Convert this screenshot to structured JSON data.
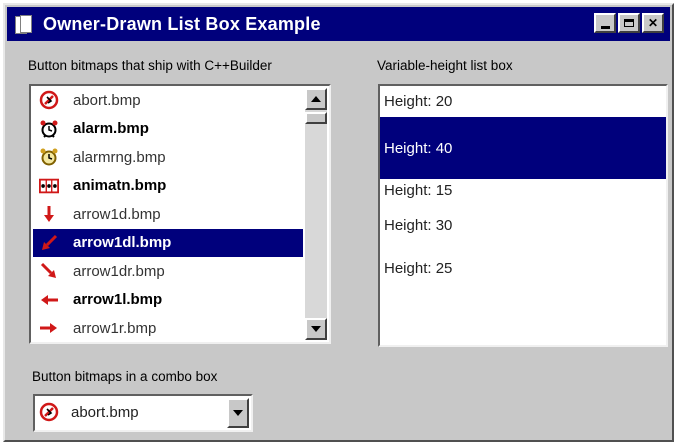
{
  "window": {
    "title": "Owner-Drawn List Box Example"
  },
  "left_list": {
    "label": "Button bitmaps that ship with C++Builder",
    "items": [
      {
        "label": "abort.bmp",
        "icon": "abort-icon",
        "bold": false,
        "selected": false
      },
      {
        "label": "alarm.bmp",
        "icon": "alarm-clock-icon",
        "bold": true,
        "selected": false
      },
      {
        "label": "alarmrng.bmp",
        "icon": "alarm-ringing-icon",
        "bold": false,
        "selected": false
      },
      {
        "label": "animatn.bmp",
        "icon": "animation-icon",
        "bold": true,
        "selected": false
      },
      {
        "label": "arrow1d.bmp",
        "icon": "arrow-down-icon",
        "bold": false,
        "selected": false
      },
      {
        "label": "arrow1dl.bmp",
        "icon": "arrow-down-left-icon",
        "bold": true,
        "selected": true
      },
      {
        "label": "arrow1dr.bmp",
        "icon": "arrow-down-right-icon",
        "bold": false,
        "selected": false
      },
      {
        "label": "arrow1l.bmp",
        "icon": "arrow-left-icon",
        "bold": true,
        "selected": false
      },
      {
        "label": "arrow1r.bmp",
        "icon": "arrow-right-icon",
        "bold": false,
        "selected": false
      }
    ]
  },
  "right_list": {
    "label": "Variable-height list box",
    "items": [
      {
        "label": "Height: 20",
        "height": 20,
        "selected": false
      },
      {
        "label": "Height: 40",
        "height": 40,
        "selected": true
      },
      {
        "label": "Height: 15",
        "height": 15,
        "selected": false
      },
      {
        "label": "Height: 30",
        "height": 30,
        "selected": false
      },
      {
        "label": "Height: 25",
        "height": 25,
        "selected": false
      }
    ]
  },
  "combo": {
    "label": "Button bitmaps in a combo box",
    "value": "abort.bmp",
    "icon": "abort-icon"
  },
  "colors": {
    "titlebar": "#00007c",
    "selection": "#00007c",
    "face": "#c8c8c8",
    "icon_red": "#d01818"
  }
}
